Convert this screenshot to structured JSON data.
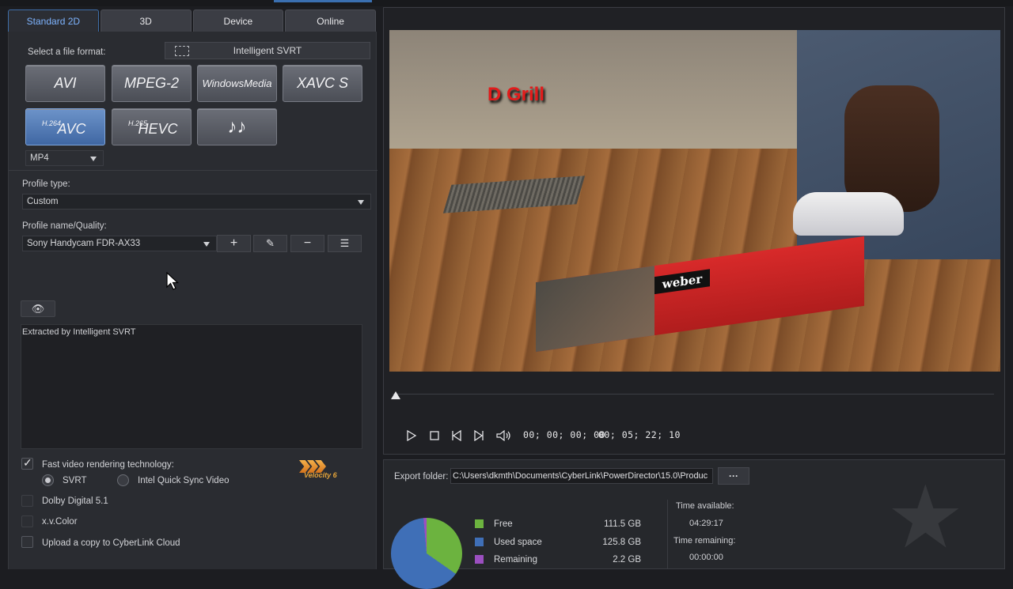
{
  "tabs": [
    {
      "label": "Standard 2D",
      "active": true
    },
    {
      "label": "3D",
      "active": false
    },
    {
      "label": "Device",
      "active": false
    },
    {
      "label": "Online",
      "active": false
    }
  ],
  "format": {
    "select_label": "Select a file format:",
    "svrt_button": "Intelligent SVRT",
    "buttons": [
      {
        "name": "AVI",
        "prefix": ""
      },
      {
        "name": "MPEG-2",
        "prefix": ""
      },
      {
        "name": "WindowsMedia",
        "prefix": ""
      },
      {
        "name": "XAVC S",
        "prefix": ""
      },
      {
        "name": "AVC",
        "prefix": "H.264",
        "selected": true
      },
      {
        "name": "HEVC",
        "prefix": "H.265"
      },
      {
        "name": "♪♪",
        "prefix": ""
      }
    ],
    "container_value": "MP4"
  },
  "profile": {
    "type_label": "Profile type:",
    "type_value": "Custom",
    "name_label": "Profile name/Quality:",
    "name_value": "Sony Handycam FDR-AX33",
    "add_icon": "+",
    "edit_icon": "✎",
    "remove_icon": "−",
    "details_icon": "☰"
  },
  "description": "Extracted by Intelligent SVRT",
  "options": {
    "fast_render_label": "Fast video rendering technology:",
    "svrt_label": "SVRT",
    "quicksync_label": "Intel Quick Sync Video",
    "dolby_label": "Dolby Digital 5.1",
    "xvcolor_label": "x.v.Color",
    "upload_label": "Upload a copy to CyberLink Cloud",
    "tv_badge": "Velocity 6"
  },
  "preview": {
    "overlay_title": "D Grill",
    "box_logo": "weber",
    "timecode_current": "00; 00; 00; 00",
    "timecode_total": "00; 05; 22; 10"
  },
  "export": {
    "folder_label": "Export folder:",
    "folder_path": "C:\\Users\\dkmth\\Documents\\CyberLink\\PowerDirector\\15.0\\Produc",
    "browse_label": "···"
  },
  "disk": {
    "legend": [
      {
        "label": "Free",
        "value": "111.5  GB",
        "color": "#6cb33f"
      },
      {
        "label": "Used space",
        "value": "125.8  GB",
        "color": "#3f6fb7"
      },
      {
        "label": "Remaining",
        "value": "2.2  GB",
        "color": "#9b4fc0"
      }
    ],
    "time_available_label": "Time available:",
    "time_available": "04:29:17",
    "time_remaining_label": "Time remaining:",
    "time_remaining": "00:00:00"
  }
}
